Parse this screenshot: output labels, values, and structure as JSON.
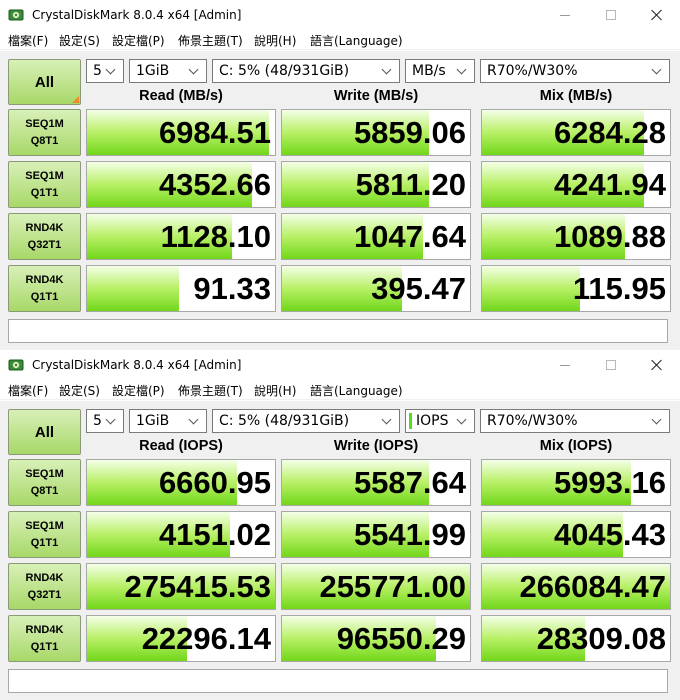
{
  "windows": [
    {
      "title": "CrystalDiskMark 8.0.4 x64 [Admin]",
      "menu": [
        "檔案(F)",
        "設定(S)",
        "設定檔(P)",
        "佈景主題(T)",
        "說明(H)",
        "語言(Language)"
      ],
      "all_label": "All",
      "count": "5",
      "size": "1GiB",
      "drive": "C: 5% (48/931GiB)",
      "unit": "MB/s",
      "mix": "R70%/W30%",
      "headers": [
        "Read (MB/s)",
        "Write (MB/s)",
        "Mix (MB/s)"
      ],
      "rows": [
        {
          "label1": "SEQ1M",
          "label2": "Q8T1",
          "read": "6984.51",
          "write": "5859.06",
          "mix": "6284.28",
          "fill": [
            0.97,
            0.78,
            0.86
          ]
        },
        {
          "label1": "SEQ1M",
          "label2": "Q1T1",
          "read": "4352.66",
          "write": "5811.20",
          "mix": "4241.94",
          "fill": [
            0.88,
            0.78,
            0.86
          ]
        },
        {
          "label1": "RND4K",
          "label2": "Q32T1",
          "read": "1128.10",
          "write": "1047.64",
          "mix": "1089.88",
          "fill": [
            0.77,
            0.75,
            0.76
          ]
        },
        {
          "label1": "RND4K",
          "label2": "Q1T1",
          "read": "91.33",
          "write": "395.47",
          "mix": "115.95",
          "fill": [
            0.49,
            0.64,
            0.52
          ]
        }
      ],
      "status": ""
    },
    {
      "title": "CrystalDiskMark 8.0.4 x64 [Admin]",
      "menu": [
        "檔案(F)",
        "設定(S)",
        "設定檔(P)",
        "佈景主題(T)",
        "說明(H)",
        "語言(Language)"
      ],
      "all_label": "All",
      "count": "5",
      "size": "1GiB",
      "drive": "C: 5% (48/931GiB)",
      "unit": "IOPS",
      "mix": "R70%/W30%",
      "headers": [
        "Read (IOPS)",
        "Write (IOPS)",
        "Mix (IOPS)"
      ],
      "rows": [
        {
          "label1": "SEQ1M",
          "label2": "Q8T1",
          "read": "6660.95",
          "write": "5587.64",
          "mix": "5993.16",
          "fill": [
            0.8,
            0.78,
            0.79
          ]
        },
        {
          "label1": "SEQ1M",
          "label2": "Q1T1",
          "read": "4151.02",
          "write": "5541.99",
          "mix": "4045.43",
          "fill": [
            0.76,
            0.78,
            0.75
          ]
        },
        {
          "label1": "RND4K",
          "label2": "Q32T1",
          "read": "275415.53",
          "write": "255771.00",
          "mix": "266084.47",
          "fill": [
            1.0,
            1.0,
            1.0
          ]
        },
        {
          "label1": "RND4K",
          "label2": "Q1T1",
          "read": "22296.14",
          "write": "96550.29",
          "mix": "28309.08",
          "fill": [
            0.53,
            0.82,
            0.55
          ]
        }
      ],
      "status": ""
    }
  ],
  "colors": {
    "accent_green": "#72d71a",
    "button_green": "#a8d868",
    "corner_orange": "#f08a28",
    "unit_indicator": "#55dd22"
  },
  "icons": {
    "app": "disk-icon",
    "minimize": "minimize-icon",
    "maximize": "maximize-icon",
    "close": "close-icon",
    "dropdown": "chevron-down-icon"
  }
}
